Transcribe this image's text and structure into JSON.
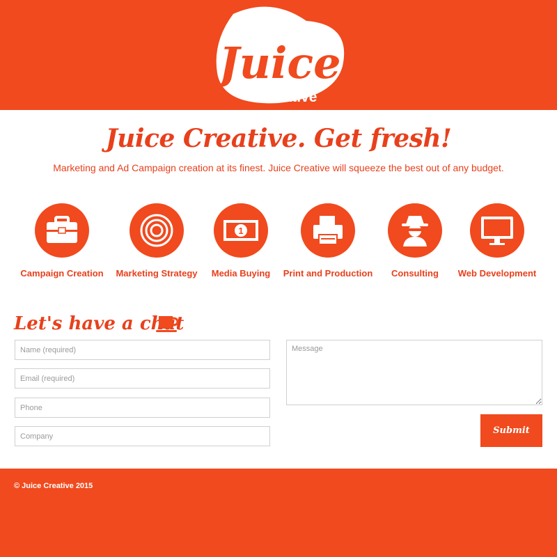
{
  "header": {
    "logo_word": "Juice",
    "logo_sub": "Creative"
  },
  "hero": {
    "tagline": "Juice Creative. Get fresh!",
    "subline": "Marketing and Ad Campaign creation at its finest. Juice Creative will squeeze the best out of any budget."
  },
  "services": [
    {
      "label": "Campaign Creation",
      "icon": "briefcase-icon"
    },
    {
      "label": "Marketing Strategy",
      "icon": "target-icon"
    },
    {
      "label": "Media Buying",
      "icon": "money-bill-icon"
    },
    {
      "label": "Print and Production",
      "icon": "printer-icon"
    },
    {
      "label": "Consulting",
      "icon": "spy-consultant-icon"
    },
    {
      "label": "Web Development",
      "icon": "monitor-icon"
    }
  ],
  "contact": {
    "title": "Let's have a chat",
    "title_icon": "coffee-cup-icon",
    "name_placeholder": "Name (required)",
    "email_placeholder": "Email (required)",
    "phone_placeholder": "Phone",
    "company_placeholder": "Company",
    "message_placeholder": "Message",
    "submit_label": "Submit"
  },
  "footer": {
    "copyright": "© Juice Creative 2015"
  },
  "colors": {
    "brand_orange": "#f04a1e",
    "text_orange": "#e8401c",
    "white": "#ffffff"
  }
}
